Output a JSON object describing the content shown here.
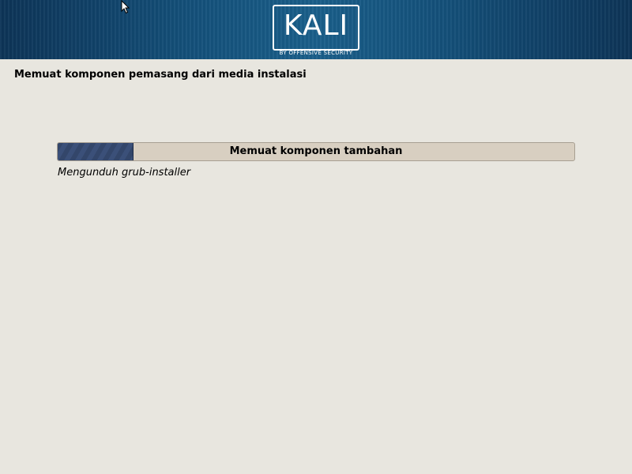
{
  "banner": {
    "logo_text": "KALI",
    "logo_subtitle": "BY OFFENSIVE SECURITY"
  },
  "installer": {
    "title": "Memuat komponen pemasang dari media instalasi",
    "progress": {
      "label": "Memuat komponen tambahan",
      "fraction": 0.145
    },
    "status_text": "Mengunduh grub-installer"
  },
  "colors": {
    "background": "#e8e6df",
    "banner": "#14507a",
    "progress_fill": "#33466a",
    "progress_track": "#d8cfc1"
  },
  "icons": {
    "cursor": "mouse-pointer-icon"
  }
}
